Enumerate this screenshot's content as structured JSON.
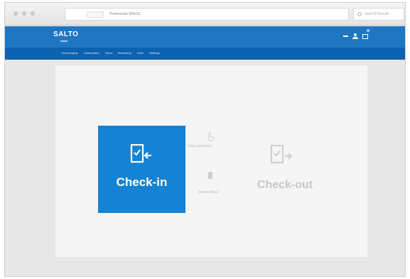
{
  "browser": {
    "address_text": "Preferential SPACE",
    "search_placeholder": "Seal Of Results"
  },
  "app": {
    "brand": "SALTO",
    "menu": [
      "Accessrights",
      "Cardholders",
      "Views",
      "Monitoring",
      "Hotel",
      "Settings"
    ]
  },
  "main": {
    "checkin_label": "Check-in",
    "checkout_label": "Check-out",
    "copy_guest_key": "Copy guest key",
    "room_status": "Room status"
  },
  "colors": {
    "appbar": "#1f77c2",
    "menubar": "#0d62b0",
    "checkin_tile": "#1483d4",
    "disabled_text": "#c7c7c7"
  }
}
